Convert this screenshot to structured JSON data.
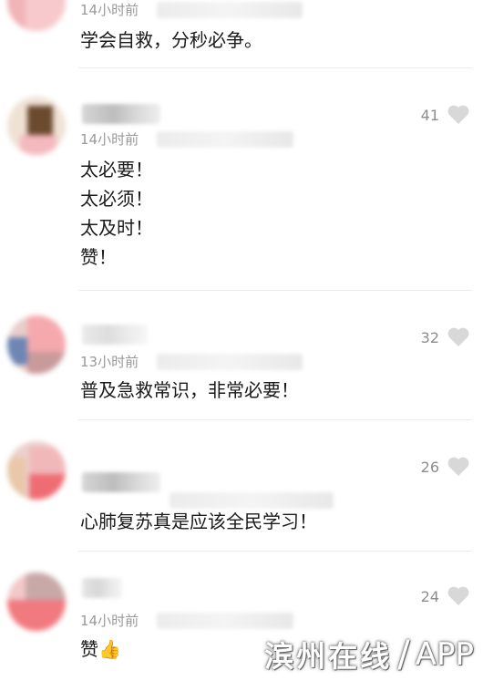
{
  "comments": [
    {
      "time": "14小时前",
      "text": "学会自救，分秒必争。",
      "likes": ""
    },
    {
      "time": "14小时前",
      "text": "太必要！\n太必须！\n太及时！\n赞！",
      "likes": "41"
    },
    {
      "time": "13小时前",
      "text": "普及急救常识，非常必要！",
      "likes": "32"
    },
    {
      "time": "",
      "text": "心肺复苏真是应该全民学习！",
      "likes": "26"
    },
    {
      "time": "14小时前",
      "text": "赞👍",
      "likes": "24"
    }
  ],
  "watermark": {
    "name": "滨州在线",
    "slash": "/",
    "suffix": "APP"
  },
  "icons": {
    "like": "heart-icon",
    "brand": "watermark-logo"
  },
  "colors": {
    "text": "#1a1a1a",
    "meta": "#9a9a9a",
    "heart": "#d8d8d8"
  }
}
